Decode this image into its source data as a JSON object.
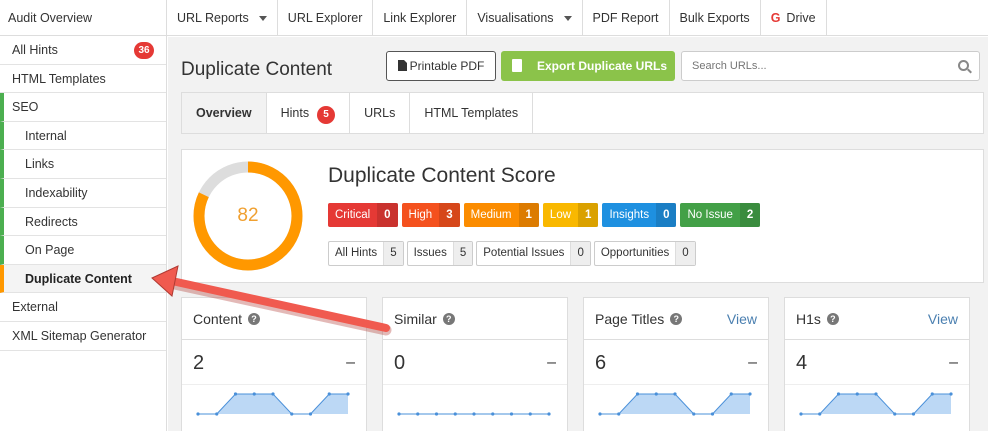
{
  "topnav": {
    "brand": "Audit Overview",
    "items": [
      {
        "label": "URL Reports",
        "dropdown": true
      },
      {
        "label": "URL Explorer",
        "dropdown": false
      },
      {
        "label": "Link Explorer",
        "dropdown": false
      },
      {
        "label": "Visualisations",
        "dropdown": true
      },
      {
        "label": "PDF Report",
        "dropdown": false
      },
      {
        "label": "Bulk Exports",
        "dropdown": false
      },
      {
        "label": "Drive",
        "icon": "google-g-icon"
      }
    ]
  },
  "sidebar": {
    "items": [
      {
        "label": "All Hints",
        "badge": "36"
      },
      {
        "label": "HTML Templates"
      },
      {
        "label": "SEO"
      },
      {
        "label": "Internal"
      },
      {
        "label": "Links"
      },
      {
        "label": "Indexability"
      },
      {
        "label": "Redirects"
      },
      {
        "label": "On Page"
      },
      {
        "label": "Duplicate Content",
        "active": true
      },
      {
        "label": "External"
      },
      {
        "label": "XML Sitemap Generator"
      }
    ]
  },
  "main": {
    "title": "Duplicate Content",
    "printable_pdf": "Printable PDF",
    "export_label": "Export Duplicate URLs",
    "search_placeholder": "Search URLs...",
    "tabs": [
      {
        "label": "Overview",
        "active": true
      },
      {
        "label": "Hints",
        "badge": "5"
      },
      {
        "label": "URLs"
      },
      {
        "label": "HTML Templates"
      }
    ],
    "score": {
      "title": "Duplicate Content Score",
      "value": "82",
      "fraction": 0.82,
      "severities": [
        {
          "label": "Critical",
          "count": "0",
          "color": "#e53935"
        },
        {
          "label": "High",
          "count": "3",
          "color": "#f4511e"
        },
        {
          "label": "Medium",
          "count": "1",
          "color": "#fb8c00"
        },
        {
          "label": "Low",
          "count": "1",
          "color": "#f9b800"
        },
        {
          "label": "Insights",
          "count": "0",
          "color": "#1e90e0"
        },
        {
          "label": "No Issue",
          "count": "2",
          "color": "#43a047"
        }
      ],
      "hint_types": [
        {
          "label": "All Hints",
          "count": "5"
        },
        {
          "label": "Issues",
          "count": "5"
        },
        {
          "label": "Potential Issues",
          "count": "0"
        },
        {
          "label": "Opportunities",
          "count": "0"
        }
      ]
    },
    "cards": [
      {
        "title": "Content",
        "value": "2",
        "dash": "–",
        "view": "",
        "spark": [
          0,
          0,
          1,
          1,
          1,
          0,
          0,
          1,
          1
        ]
      },
      {
        "title": "Similar",
        "value": "0",
        "dash": "–",
        "view": "",
        "spark": [
          0,
          0,
          0,
          0,
          0,
          0,
          0,
          0,
          0
        ]
      },
      {
        "title": "Page Titles",
        "value": "6",
        "dash": "–",
        "view": "View",
        "spark": [
          0,
          0,
          1,
          1,
          1,
          0,
          0,
          1,
          1
        ]
      },
      {
        "title": "H1s",
        "value": "4",
        "dash": "–",
        "view": "View",
        "spark": [
          0,
          0,
          1,
          1,
          1,
          0,
          0,
          1,
          1
        ]
      }
    ]
  },
  "colors": {
    "accent_green": "#8bc34a",
    "ring_orange": "#ff9800",
    "ring_track": "#dddddd",
    "spark_line": "#4a90d9",
    "spark_fill": "#bcd8f5",
    "arrow_red": "#f05a4f"
  }
}
